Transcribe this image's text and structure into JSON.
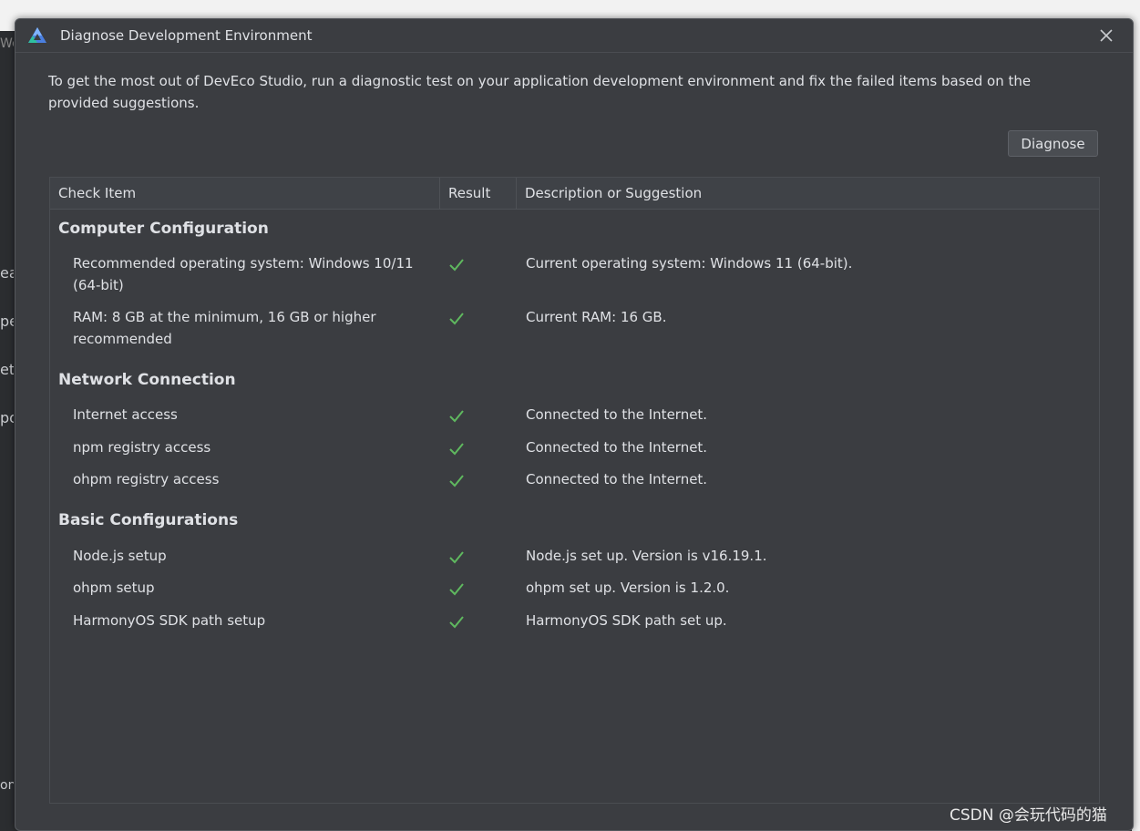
{
  "dialog": {
    "title": "Diagnose Development Environment",
    "intro": "To get the most out of DevEco Studio, run a diagnostic test on your application development environment and fix the failed items based on the provided suggestions.",
    "diagnose_label": "Diagnose",
    "accent_color": "#5fb85f"
  },
  "table": {
    "headers": [
      "Check Item",
      "Result",
      "Description or Suggestion"
    ],
    "groups": [
      {
        "name": "Computer Configuration",
        "rows": [
          {
            "item": "Recommended operating system: Windows 10/11 (64-bit)",
            "result": "check-icon",
            "desc": "Current operating system: Windows 11 (64-bit)."
          },
          {
            "item": "RAM: 8 GB at the minimum, 16 GB or higher recommended",
            "result": "check-icon",
            "desc": "Current RAM: 16 GB."
          }
        ]
      },
      {
        "name": "Network Connection",
        "rows": [
          {
            "item": "Internet access",
            "result": "check-icon",
            "desc": "Connected to the Internet."
          },
          {
            "item": "npm registry access",
            "result": "check-icon",
            "desc": "Connected to the Internet."
          },
          {
            "item": "ohpm registry access",
            "result": "check-icon",
            "desc": "Connected to the Internet."
          }
        ]
      },
      {
        "name": "Basic Configurations",
        "rows": [
          {
            "item": "Node.js setup",
            "result": "check-icon",
            "desc": "Node.js set up. Version is v16.19.1."
          },
          {
            "item": "ohpm setup",
            "result": "check-icon",
            "desc": "ohpm set up. Version is 1.2.0."
          },
          {
            "item": "HarmonyOS SDK path setup",
            "result": "check-icon",
            "desc": "HarmonyOS SDK path set up."
          }
        ]
      }
    ]
  },
  "background": {
    "fragments": [
      "We",
      "ea",
      "pe",
      "et",
      "po",
      "on"
    ]
  },
  "watermark": "CSDN @会玩代码的猫"
}
